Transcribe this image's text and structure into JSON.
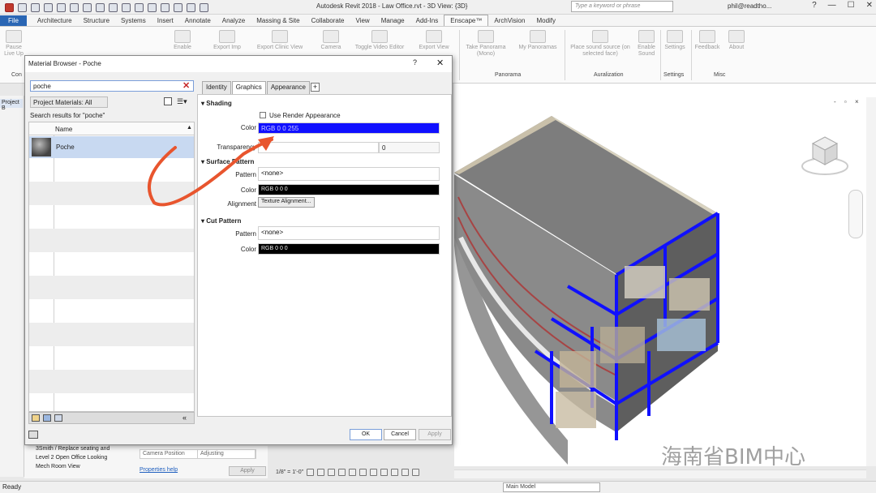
{
  "app": {
    "title": "Autodesk Revit 2018 -   Law Office.rvt - 3D View: {3D}",
    "search_placeholder": "Type a keyword or phrase",
    "user": "phil@readtho...",
    "help": "?"
  },
  "ribbon_tabs": [
    "File",
    "Architecture",
    "Structure",
    "Systems",
    "Insert",
    "Annotate",
    "Analyze",
    "Massing & Site",
    "Collaborate",
    "View",
    "Manage",
    "Add-Ins",
    "Enscape™",
    "ArchVision",
    "Modify"
  ],
  "ribbon": {
    "buttons": [
      {
        "label": "Pause Live Up"
      },
      {
        "label": "Enable"
      },
      {
        "label": "Export Imp"
      },
      {
        "label": "Export Clinic View"
      },
      {
        "label": "Camera"
      },
      {
        "label": "Toggle Video Editor"
      },
      {
        "label": "Export View"
      },
      {
        "label": "Take Panorama (Mono)"
      },
      {
        "label": "My Panoramas"
      },
      {
        "label": "Place sound source (on selected face)"
      },
      {
        "label": "Enable Sound"
      },
      {
        "label": "Settings"
      },
      {
        "label": "Feedback"
      },
      {
        "label": "About"
      }
    ],
    "panels": [
      "Con",
      "Panorama",
      "Auralization",
      "Settings",
      "Misc"
    ]
  },
  "left_panel": {
    "header": "Project B"
  },
  "dialog": {
    "title": "Material Browser - Poche",
    "help": "?",
    "close": "✕",
    "search_value": "poche",
    "filter": "Project Materials: All",
    "results_text": "Search results for \"poche\"",
    "column_name": "Name",
    "item": "Poche",
    "tabs": [
      "Identity",
      "Graphics",
      "Appearance"
    ],
    "add_tab": "+",
    "shading": {
      "header": "Shading",
      "use_render": "Use Render Appearance",
      "color_label": "Color",
      "color_value": "RGB 0 0 255",
      "transparency_label": "Transparency",
      "transparency_value": "0"
    },
    "surface": {
      "header": "Surface Pattern",
      "pattern_label": "Pattern",
      "pattern_value": "<none>",
      "color_label": "Color",
      "color_value": "RGB 0 0 0",
      "alignment_label": "Alignment",
      "alignment_button": "Texture Alignment..."
    },
    "cut": {
      "header": "Cut Pattern",
      "pattern_label": "Pattern",
      "pattern_value": "<none>",
      "color_label": "Color",
      "color_value": "RGB 0 0 0"
    },
    "ok": "OK",
    "cancel": "Cancel",
    "apply": "Apply"
  },
  "project_tree": [
    "3Smith / Replace seating and",
    "Level 2 Open Office Looking",
    "Mech Room View"
  ],
  "properties": {
    "camera_label": "Camera Position",
    "camera_value": "Adjusting",
    "help_link": "Properties help",
    "apply": "Apply"
  },
  "view_control": {
    "scale": "1/8\" = 1'-0\""
  },
  "status": {
    "ready": "Ready",
    "main_model": "Main Model"
  },
  "watermark": "海南省BIM中心",
  "colors": {
    "accent_blue": "#1010ff",
    "arrow": "#e8552e",
    "file_tab": "#2a66b4"
  }
}
